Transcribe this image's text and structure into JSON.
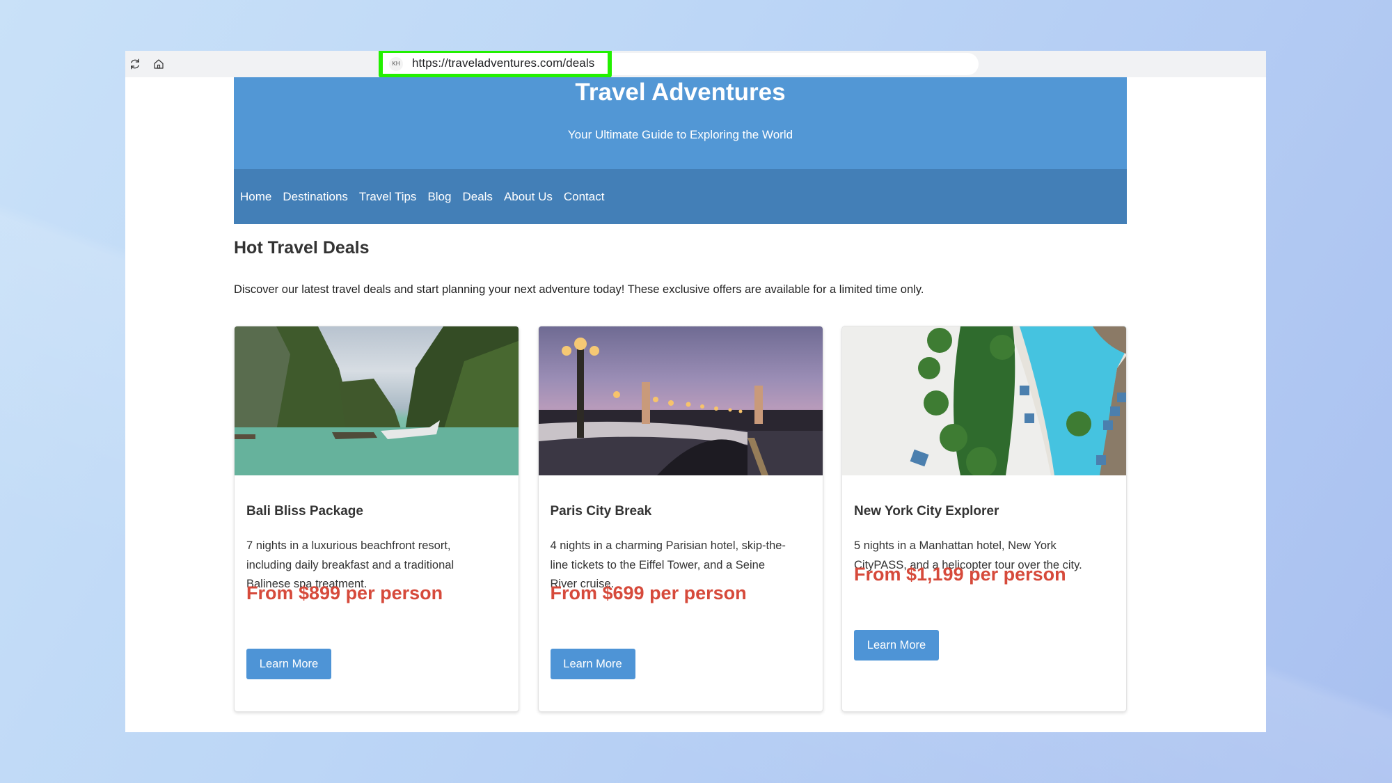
{
  "browser": {
    "url": "https://traveladventures.com/deals",
    "site_badge": "KH",
    "highlight_color": "#22f000"
  },
  "header": {
    "title": "Travel Adventures",
    "tagline": "Your Ultimate Guide to Exploring the World",
    "bg_color": "#5297d5",
    "nav_bg_color": "#437fb7"
  },
  "nav": {
    "items": [
      "Home",
      "Destinations",
      "Travel Tips",
      "Blog",
      "Deals",
      "About Us",
      "Contact"
    ]
  },
  "main": {
    "title": "Hot Travel Deals",
    "description": "Discover our latest travel deals and start planning your next adventure today! These exclusive offers are available for a limited time only."
  },
  "deals": [
    {
      "image": "limestone-cliffs-lagoon-with-longtail-boats",
      "title": "Bali Bliss Package",
      "description": "7 nights in a luxurious beachfront resort, including daily breakfast and a traditional Balinese spa treatment.",
      "price": "From $899 per person",
      "button": "Learn More"
    },
    {
      "image": "pont-alexandre-iii-bridge-at-dusk",
      "title": "Paris City Break",
      "description": "4 nights in a charming Parisian hotel, skip-the-line tickets to the Eiffel Tower, and a Seine River cruise.",
      "price": "From $699 per person",
      "button": "Learn More"
    },
    {
      "image": "aerial-resort-pool-with-palm-trees",
      "title": "New York City Explorer",
      "description": "5 nights in a Manhattan hotel, New York CityPASS, and a helicopter tour over the city.",
      "price": "From $1,199 per person",
      "button": "Learn More"
    }
  ],
  "colors": {
    "price": "#d64a3b",
    "button": "#4e94d6"
  }
}
